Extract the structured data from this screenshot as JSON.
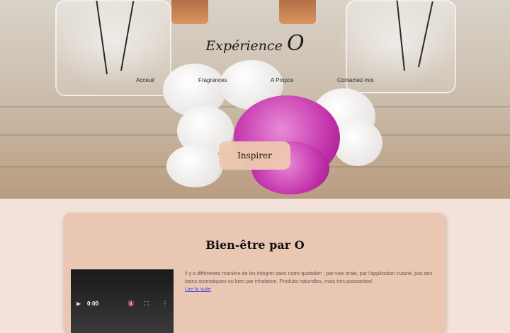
{
  "brand": {
    "logo_prefix": "Expérience",
    "logo_letter": "O"
  },
  "nav": {
    "items": [
      {
        "label": "Acceuil"
      },
      {
        "label": "Fragrances"
      },
      {
        "label": "A Propos"
      },
      {
        "label": "Contactez-moi"
      }
    ]
  },
  "hero": {
    "button_label": "Inspirer"
  },
  "section": {
    "title": "Bien-être par O",
    "description": "Il y a différentes manière de les intégrer dans notre quotidien : par voie orale, par l'application cutané, pas des bains aromatiques ou bien par inhalation. Produits naturelles, mais très puissantes!",
    "read_more": "Lire la suite",
    "video": {
      "time": "0:00"
    }
  },
  "colors": {
    "page_bg": "#f2e2da",
    "card_bg": "#e9c7b3",
    "button_bg": "#edc8b0",
    "link": "#4a3ed1"
  }
}
